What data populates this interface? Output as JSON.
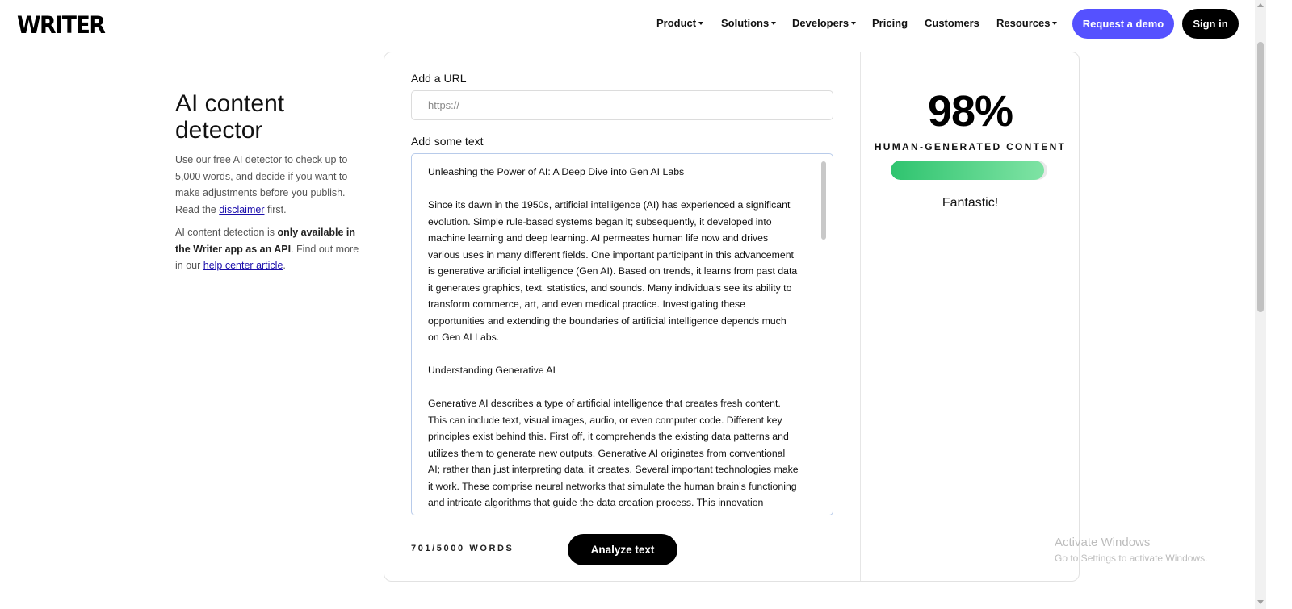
{
  "header": {
    "logo": "WRITER",
    "nav": [
      {
        "label": "Product",
        "dropdown": true
      },
      {
        "label": "Solutions",
        "dropdown": true
      },
      {
        "label": "Developers",
        "dropdown": true
      },
      {
        "label": "Pricing",
        "dropdown": false
      },
      {
        "label": "Customers",
        "dropdown": false
      },
      {
        "label": "Resources",
        "dropdown": true
      }
    ],
    "demo_button": "Request a demo",
    "signin_button": "Sign in",
    "colors": {
      "demo_bg": "#5551ff",
      "signin_bg": "#000000"
    }
  },
  "intro": {
    "title_line1": "AI content",
    "title_line2": "detector",
    "p1_before": "Use our free AI detector to check up to 5,000 words, and decide if you want to make adjustments before you publish. Read the ",
    "p1_link": "disclaimer",
    "p1_after": " first.",
    "p2_before": "AI content detection is ",
    "p2_bold": "only available in the Writer app as an API",
    "p2_mid": ". Find out more in our ",
    "p2_link": "help center article",
    "p2_after": "."
  },
  "form": {
    "url_label": "Add a URL",
    "url_placeholder": "https://",
    "text_label": "Add some text",
    "text_paragraphs": [
      "Unleashing the Power of AI: A Deep Dive into Gen AI Labs",
      "Since its dawn in the 1950s, artificial intelligence (AI) has experienced a significant evolution. Simple rule-based systems began it; subsequently, it developed into machine learning and deep learning. AI permeates human life now and drives various uses in many different fields. One important participant in this advancement is generative artificial intelligence (Gen AI). Based on trends, it learns from past data it generates graphics, text, statistics, and sounds. Many individuals see its ability to transform commerce, art, and even medical practice. Investigating these opportunities and extending the boundaries of artificial intelligence depends much on Gen AI Labs.",
      "Understanding Generative AI",
      "Generative AI describes a type of artificial intelligence that creates fresh content. This can include text, visual images, audio, or even computer code. Different key principles exist behind this. First off, it comprehends the existing data patterns and utilizes them to generate new outputs. Generative AI originates from conventional AI; rather than just interpreting data, it creates. Several important technologies make it work. These comprise neural networks that simulate the human brain's functioning and intricate algorithms that guide the data creation process. This innovation supports deep Generative Statistical"
    ],
    "word_count": "701/5000 WORDS",
    "analyze_button": "Analyze text"
  },
  "result": {
    "score": "98%",
    "score_label": "HUMAN-GENERATED CONTENT",
    "bar_fraction": 0.98,
    "verdict": "Fantastic!",
    "colors": {
      "bar_start": "#2fc46f",
      "bar_end": "#7fe3a4"
    }
  },
  "watermark": {
    "line1": "Activate Windows",
    "line2": "Go to Settings to activate Windows."
  }
}
